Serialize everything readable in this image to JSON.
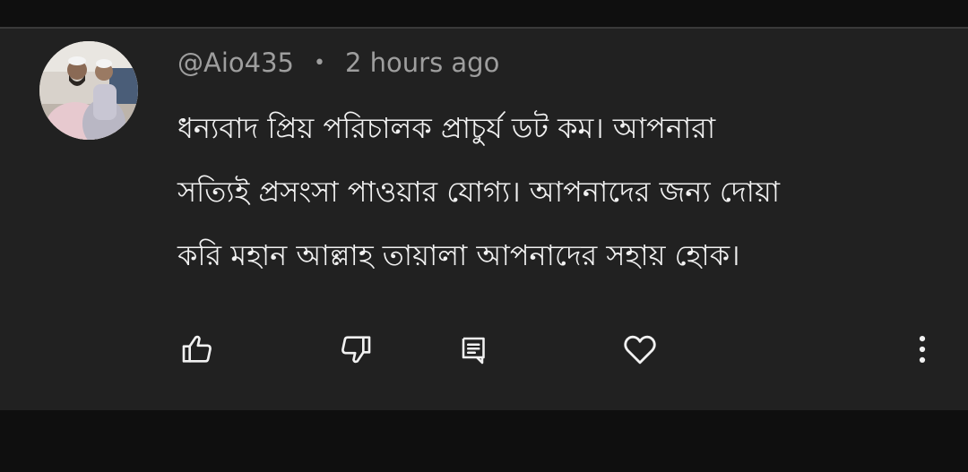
{
  "comment": {
    "author": "@Aio435",
    "separator": "•",
    "timestamp": "2 hours ago",
    "text_lines": [
      "ধন্যবাদ প্রিয় পরিচালক প্রাচুর্য ডট কম। আপনারা",
      "সত্যিই প্রসংসা পাওয়ার যোগ্য। আপনাদের জন্য দোয়া",
      "করি মহান আল্লাহ তায়ালা আপনাদের সহায় হোক।"
    ]
  },
  "actions": {
    "like_icon": "thumbs-up-icon",
    "dislike_icon": "thumbs-down-icon",
    "reply_icon": "reply-icon",
    "heart_icon": "heart-icon",
    "more_icon": "more-vertical-icon"
  },
  "colors": {
    "background": "#0f0f0f",
    "card": "#212121",
    "text": "#f1f1f1",
    "meta": "#9e9e9e",
    "icon": "#f1f1f1"
  }
}
